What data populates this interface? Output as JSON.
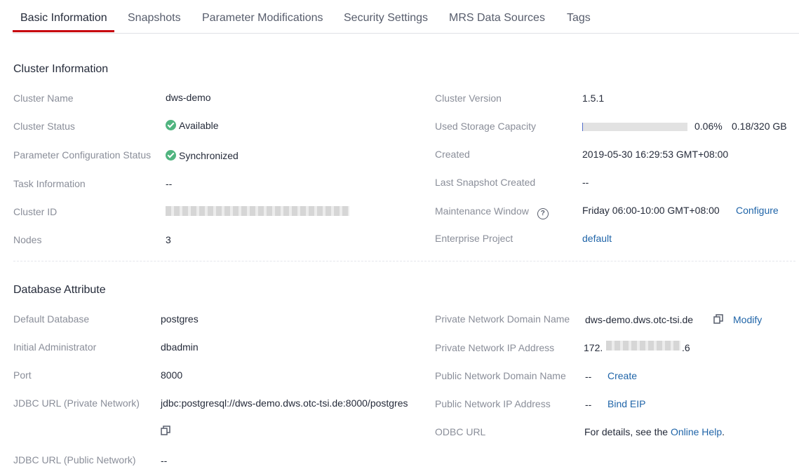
{
  "tabs": [
    {
      "label": "Basic Information",
      "active": true
    },
    {
      "label": "Snapshots"
    },
    {
      "label": "Parameter Modifications"
    },
    {
      "label": "Security Settings"
    },
    {
      "label": "MRS Data Sources"
    },
    {
      "label": "Tags"
    }
  ],
  "cluster_info": {
    "title": "Cluster Information",
    "name_label": "Cluster Name",
    "name": "dws-demo",
    "status_label": "Cluster Status",
    "status": "Available",
    "param_status_label": "Parameter Configuration Status",
    "param_status": "Synchronized",
    "task_label": "Task Information",
    "task": "--",
    "id_label": "Cluster ID",
    "nodes_label": "Nodes",
    "nodes": "3",
    "version_label": "Cluster Version",
    "version": "1.5.1",
    "storage_label": "Used Storage Capacity",
    "storage_percent": "0.06%",
    "storage_amount": "0.18/320 GB",
    "storage_fraction": 0.0006,
    "created_label": "Created",
    "created": "2019-05-30 16:29:53 GMT+08:00",
    "last_snapshot_label": "Last Snapshot Created",
    "last_snapshot": "--",
    "maintenance_label": "Maintenance Window",
    "maintenance": "Friday 06:00-10:00 GMT+08:00",
    "configure_link": "Configure",
    "enterprise_label": "Enterprise Project",
    "enterprise": "default"
  },
  "db_attr": {
    "title": "Database Attribute",
    "default_db_label": "Default Database",
    "default_db": "postgres",
    "admin_label": "Initial Administrator",
    "admin": "dbadmin",
    "port_label": "Port",
    "port": "8000",
    "jdbc_private_label": "JDBC URL (Private Network)",
    "jdbc_private": "jdbc:postgresql://dws-demo.dws.otc-tsi.de:8000/postgres",
    "jdbc_public_label": "JDBC URL (Public Network)",
    "jdbc_public": "--",
    "private_domain_label": "Private Network Domain Name",
    "private_domain": "dws-demo.dws.otc-tsi.de",
    "modify_link": "Modify",
    "private_ip_label": "Private Network IP Address",
    "private_ip_prefix": "172.",
    "private_ip_suffix": ".6",
    "public_domain_label": "Public Network Domain Name",
    "public_domain": "--",
    "create_link": "Create",
    "public_ip_label": "Public Network IP Address",
    "public_ip": "--",
    "bind_eip_link": "Bind EIP",
    "odbc_label": "ODBC URL",
    "odbc_prefix": "For details, see the ",
    "odbc_link": "Online Help",
    "odbc_suffix": "."
  },
  "colors": {
    "accent": "#c7000b",
    "link": "#1f64a8",
    "success": "#50b47f"
  },
  "icons": [
    "check-circle-icon",
    "help-icon",
    "copy-icon"
  ]
}
